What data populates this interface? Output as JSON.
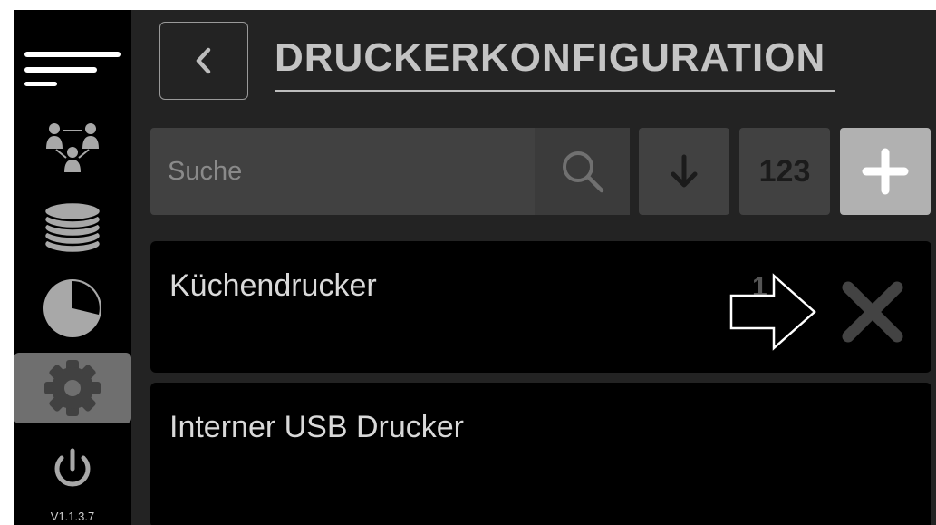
{
  "sidebar": {
    "items": [
      {
        "name": "menu",
        "icon": "hamburger-menu-icon"
      },
      {
        "name": "users",
        "icon": "user-network-icon"
      },
      {
        "name": "database",
        "icon": "database-icon"
      },
      {
        "name": "statistics",
        "icon": "pie-chart-icon"
      },
      {
        "name": "settings",
        "icon": "gear-icon",
        "active": true
      },
      {
        "name": "power",
        "icon": "power-icon"
      }
    ],
    "version": "V1.1.3.7"
  },
  "header": {
    "back_icon": "chevron-left-icon",
    "title": "DRUCKERKONFIGURATION"
  },
  "toolbar": {
    "search_placeholder": "Suche",
    "search_value": "",
    "search_icon": "search-icon",
    "sort_icon": "arrow-down-icon",
    "numeric_label": "123",
    "add_icon": "plus-icon"
  },
  "printers": [
    {
      "name": "Küchendrucker",
      "badge": "1",
      "delete_icon": "close-icon",
      "pointer_icon": "right-arrow-outline-icon"
    },
    {
      "name": "Interner USB Drucker"
    }
  ],
  "colors": {
    "app_background": "#000000",
    "main_background": "#232323",
    "active_sidebar": "#6f6f6f",
    "add_button": "#b1b1b1"
  }
}
